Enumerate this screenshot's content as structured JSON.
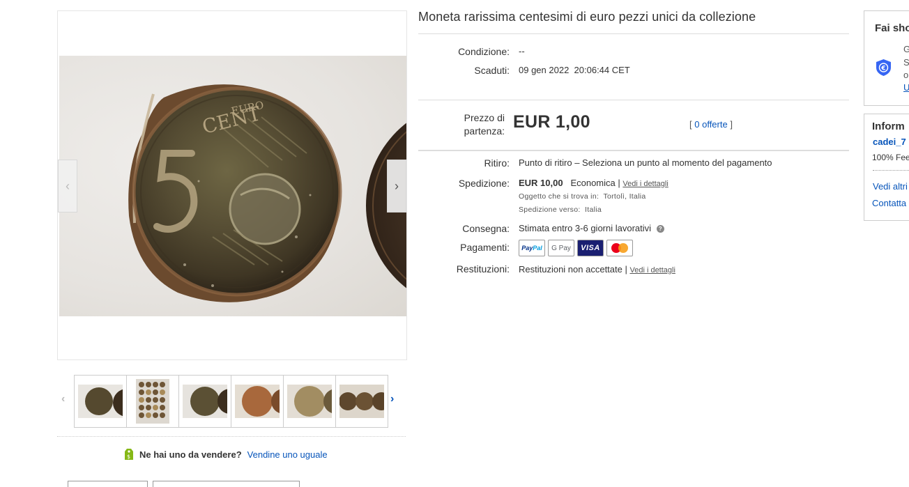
{
  "item": {
    "title": "Moneta rarissima centesimi di euro pezzi unici da collezione",
    "condition_label": "Condizione:",
    "condition_value": "--",
    "ended_label": "Scaduti:",
    "ended_date": "09 gen 2022",
    "ended_time": "20:06:44 CET"
  },
  "price": {
    "label_line1": "Prezzo di",
    "label_line2": "partenza:",
    "value": "EUR 1,00",
    "offers_open": "[",
    "offers_link": "0 offerte",
    "offers_close": "]"
  },
  "pickup": {
    "label": "Ritiro:",
    "value": "Punto di ritiro – Seleziona un punto al momento del pagamento"
  },
  "shipping": {
    "label": "Spedizione:",
    "cost": "EUR 10,00",
    "service": "Economica |",
    "details_link": "Vedi i dettagli",
    "location_label": "Oggetto che si trova in:",
    "location_value": "Tortolì, Italia",
    "ships_to_label": "Spedizione verso:",
    "ships_to_value": "Italia"
  },
  "delivery": {
    "label": "Consegna:",
    "value": "Stimata entro 3-6 giorni lavorativi",
    "help_icon": "?"
  },
  "payments": {
    "label": "Pagamenti:",
    "methods": [
      "PayPal",
      "G Pay",
      "VISA",
      "Mastercard"
    ]
  },
  "returns": {
    "label": "Restituzioni:",
    "value": "Restituzioni non accettate |",
    "details_link": "Vedi i dettagli"
  },
  "sell_similar": {
    "question": "Ne hai uno da vendere?",
    "link": "Vendine uno uguale"
  },
  "side_panel_1": {
    "title": "Fai sho",
    "line1": "G",
    "line2": "S",
    "line3": "o",
    "link": "U"
  },
  "side_panel_2": {
    "title": "Inform",
    "seller": "cadei_7",
    "feedback": "100% Fee",
    "link1": "Vedi altri",
    "link2": "Contatta"
  },
  "gallery": {
    "prev_arrow": "‹",
    "next_arrow": "›",
    "thumb_prev": "‹",
    "thumb_next": "›"
  },
  "colors": {
    "link": "#0654ba",
    "text": "#333333",
    "shield": "#3665f3"
  }
}
